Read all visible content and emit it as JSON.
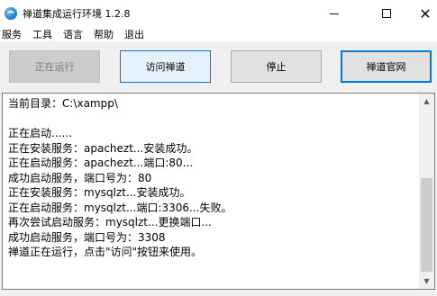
{
  "window": {
    "title": "禅道集成运行环境 1.2.8",
    "icon": "app-logo-icon",
    "controls": {
      "minimize": "minimize-icon",
      "maximize": "maximize-icon",
      "close_glyph": "✕"
    }
  },
  "menu": [
    "服务",
    "工具",
    "语言",
    "帮助",
    "退出"
  ],
  "buttons": {
    "running": "正在运行",
    "visit": "访问禅道",
    "stop": "停止",
    "site": "禅道官网"
  },
  "log": [
    "当前目录：C:\\xampp\\",
    "",
    "正在启动......",
    "正在安装服务：apachezt...安装成功。",
    "正在启动服务：apachezt...端口:80...",
    "成功启动服务，端口号为：80",
    "正在安装服务：mysqlzt...安装成功。",
    "正在启动服务：mysqlzt...端口:3306...失败。",
    "再次尝试启动服务：mysqlzt...更换端口...",
    "成功启动服务，端口号为：3308",
    "禅道正在运行，点击\"访问\"按钮来使用。"
  ],
  "scrollbar": {
    "up_glyph": "▲",
    "down_glyph": "▼"
  },
  "colors": {
    "accent": "#0078d7",
    "disabled_button": "#cccccc"
  }
}
